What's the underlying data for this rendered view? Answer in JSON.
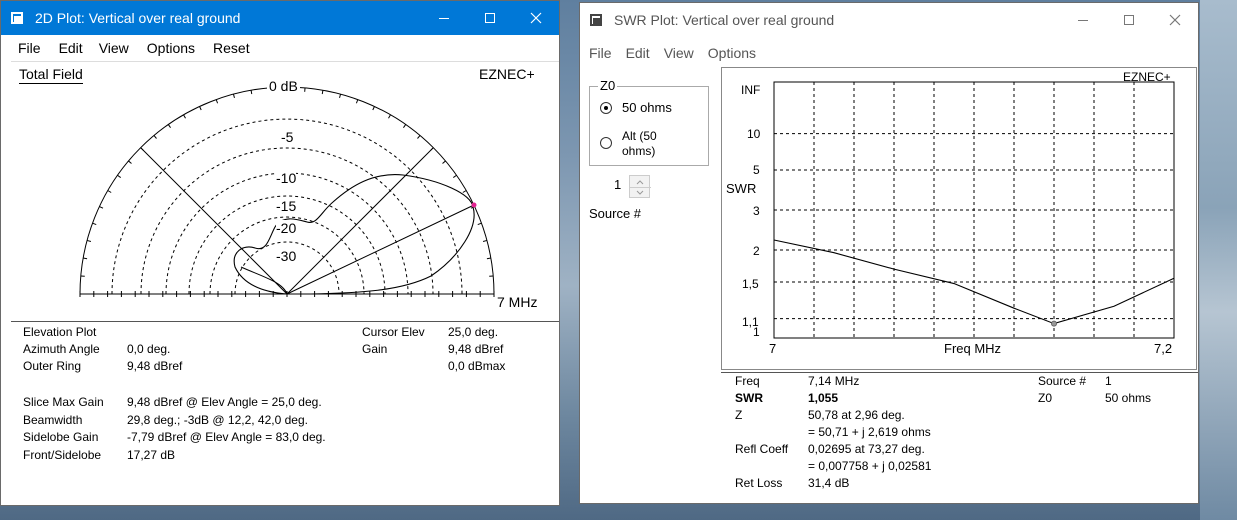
{
  "win1": {
    "title": "2D Plot: Vertical over real ground",
    "menu": [
      "File",
      "Edit",
      "View",
      "Options",
      "Reset"
    ],
    "heading": "Total Field",
    "brand": "EZNEC+",
    "ring_labels": [
      "0 dB",
      "-5",
      "-10",
      "-15",
      "-20",
      "-30"
    ],
    "freq": "7 MHz",
    "left_info": [
      [
        "Elevation Plot",
        ""
      ],
      [
        "Azimuth Angle",
        "0,0 deg."
      ],
      [
        "Outer Ring",
        "9,48 dBref"
      ]
    ],
    "cursor": [
      [
        "Cursor Elev",
        "25,0 deg."
      ],
      [
        "Gain",
        "9,48 dBref"
      ],
      [
        "",
        "0,0 dBmax"
      ]
    ],
    "stats": [
      [
        "Slice Max Gain",
        "9,48 dBref @ Elev Angle = 25,0 deg."
      ],
      [
        "Beamwidth",
        "29,8 deg.; -3dB @ 12,2, 42,0 deg."
      ],
      [
        "Sidelobe Gain",
        "-7,79 dBref @ Elev Angle = 83,0 deg."
      ],
      [
        "Front/Sidelobe",
        "17,27 dB"
      ]
    ]
  },
  "win2": {
    "title": "SWR Plot: Vertical over real ground",
    "menu": [
      "File",
      "Edit",
      "View",
      "Options"
    ],
    "z0_group": "Z0",
    "radio1": "50 ohms",
    "radio2_line1": "Alt (50",
    "radio2_line2": "ohms)",
    "source_value": "1",
    "source_label": "Source #",
    "brand": "EZNEC+",
    "ylabel": "SWR",
    "xlabel": "Freq MHz",
    "info_left": [
      [
        "Freq",
        "7,14 MHz"
      ],
      [
        "SWR",
        "1,055"
      ],
      [
        "Z",
        "50,78 at 2,96 deg."
      ],
      [
        "",
        "= 50,71 + j 2,619 ohms"
      ],
      [
        "Refl Coeff",
        "0,02695 at 73,27 deg."
      ],
      [
        "",
        "= 0,007758 + j 0,02581"
      ],
      [
        "Ret Loss",
        "31,4 dB"
      ]
    ],
    "info_right": [
      [
        "Source #",
        "1"
      ],
      [
        "Z0",
        "50 ohms"
      ]
    ]
  },
  "chart_data": {
    "type": "line",
    "ylabel": "SWR",
    "xlabel": "Freq MHz",
    "x_ticks": [
      "7",
      "7,2"
    ],
    "y_ticks": [
      "INF",
      "10",
      "5",
      "3",
      "2",
      "1,5",
      "1,1",
      "1"
    ],
    "xlim": [
      7.0,
      7.2
    ],
    "grid": true,
    "series": [
      {
        "x": [
          7.0,
          7.03,
          7.06,
          7.09,
          7.12,
          7.14,
          7.17,
          7.2
        ],
        "y": [
          2.2,
          1.95,
          1.68,
          1.48,
          1.2,
          1.055,
          1.22,
          1.55
        ]
      }
    ],
    "cursor": {
      "x": 7.14,
      "y": 1.055
    }
  },
  "colors": {
    "title_bar_active": "#0078d7",
    "marker": "#e0208f"
  }
}
